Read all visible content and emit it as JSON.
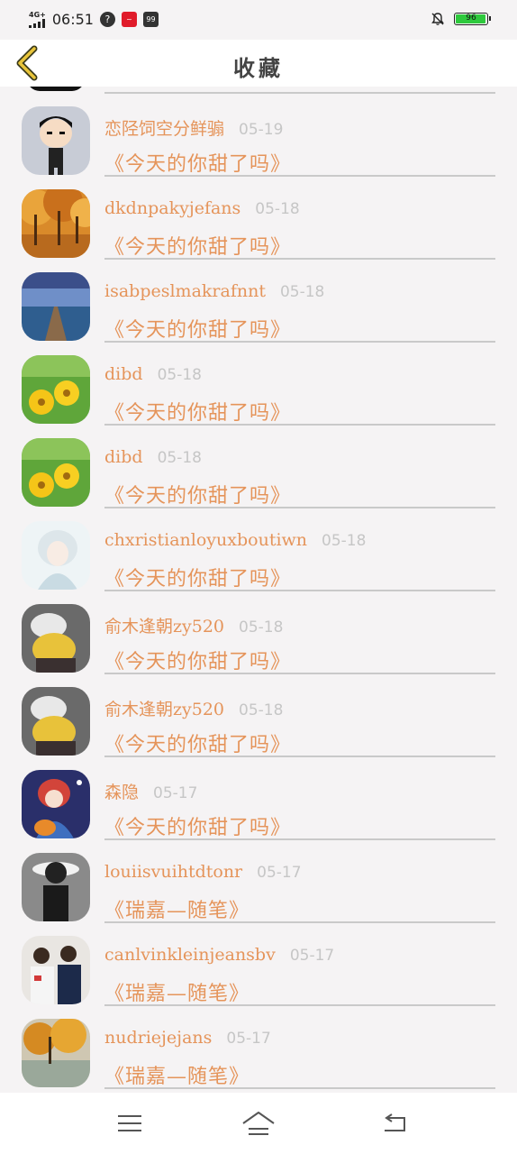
{
  "status_bar": {
    "network": "4G+",
    "time": "06:51",
    "battery": "96",
    "notif_icons": [
      "help-circle-icon",
      "red-app-icon",
      "news-app-icon"
    ],
    "app_badge_text": "99"
  },
  "header": {
    "title": "收藏"
  },
  "favorites": [
    {
      "name": "恋陉饲空分鲜骟",
      "date": "05-19",
      "work": "《今天的你甜了吗》",
      "avatar": "cartoon-boy-avatar"
    },
    {
      "name": "dkdnpakyjefans",
      "date": "05-18",
      "work": "《今天的你甜了吗》",
      "avatar": "autumn-trees-avatar"
    },
    {
      "name": "isabpeslmakrafnnt",
      "date": "05-18",
      "work": "《今天的你甜了吗》",
      "avatar": "lake-pier-avatar"
    },
    {
      "name": "dibd",
      "date": "05-18",
      "work": "《今天的你甜了吗》",
      "avatar": "yellow-flowers-avatar"
    },
    {
      "name": "dibd",
      "date": "05-18",
      "work": "《今天的你甜了吗》",
      "avatar": "yellow-flowers-avatar"
    },
    {
      "name": "chxristianloyuxboutiwn",
      "date": "05-18",
      "work": "《今天的你甜了吗》",
      "avatar": "anime-white-hair-avatar"
    },
    {
      "name": "俞木逢朝zy520",
      "date": "05-18",
      "work": "《今天的你甜了吗》",
      "avatar": "anime-couple-avatar"
    },
    {
      "name": "俞木逢朝zy520",
      "date": "05-18",
      "work": "《今天的你甜了吗》",
      "avatar": "anime-couple-avatar"
    },
    {
      "name": "森隐",
      "date": "05-17",
      "work": "《今天的你甜了吗》",
      "avatar": "anime-pumpkin-girl-avatar"
    },
    {
      "name": "louiisvuihtdtonr",
      "date": "05-17",
      "work": "《瑞嘉—随笔》",
      "avatar": "hat-girl-photo-avatar"
    },
    {
      "name": "canlvinkleinjeansbv",
      "date": "05-17",
      "work": "《瑞嘉—随笔》",
      "avatar": "couple-photo-avatar"
    },
    {
      "name": "nudriejejans",
      "date": "05-17",
      "work": "《瑞嘉—随笔》",
      "avatar": "autumn-lake-avatar"
    }
  ],
  "nav": {
    "icons": [
      "menu-icon",
      "home-icon",
      "back-return-icon"
    ]
  },
  "colors": {
    "accent": "#e5945a",
    "date": "#c6c6c6",
    "divider": "#c9c9c9"
  }
}
